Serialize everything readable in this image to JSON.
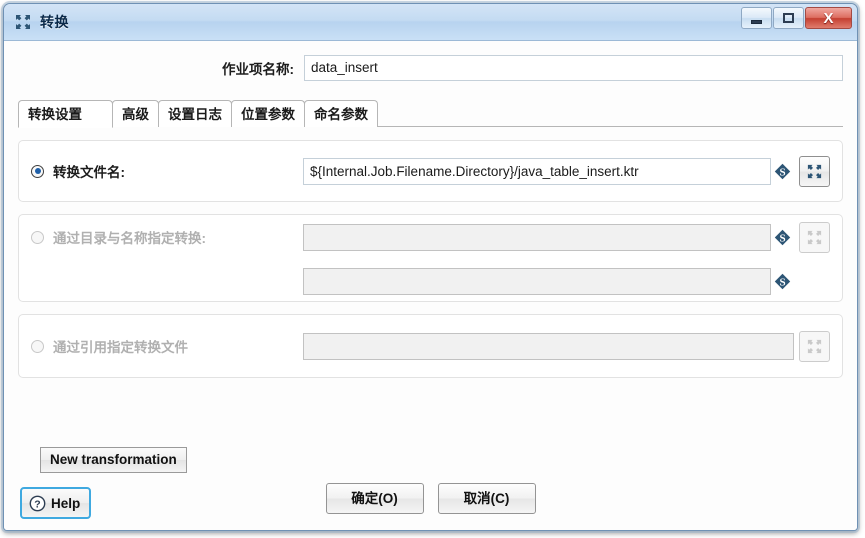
{
  "window": {
    "title": "转换",
    "title_icon": "collapse-arrows-icon",
    "controls": {
      "minimize": "minimize-icon",
      "maximize": "maximize-icon",
      "close": "X"
    }
  },
  "form": {
    "job_name_label": "作业项名称:",
    "job_name_value": "data_insert",
    "job_name_placeholder": ""
  },
  "tabs": [
    {
      "label": "转换设置",
      "active": true
    },
    {
      "label": "高级",
      "active": false
    },
    {
      "label": "设置日志",
      "active": false
    },
    {
      "label": "位置参数",
      "active": false
    },
    {
      "label": "命名参数",
      "active": false
    }
  ],
  "options": {
    "by_filename": {
      "label": "转换文件名:",
      "selected": true,
      "enabled": true,
      "value": "${Internal.Job.Filename.Directory}/java_table_insert.ktr",
      "variable_icon": "variable-dollar-icon",
      "browse_icon": "browse-collapse-icon"
    },
    "by_directory_name": {
      "label": "通过目录与名称指定转换:",
      "selected": false,
      "enabled": false,
      "directory_value": "",
      "name_value": "",
      "variable_icon": "variable-dollar-icon",
      "browse_icon": "browse-collapse-icon"
    },
    "by_reference": {
      "label": "通过引用指定转换文件",
      "selected": false,
      "enabled": false,
      "value": "",
      "browse_icon": "browse-collapse-icon"
    }
  },
  "buttons": {
    "new_transformation": "New transformation",
    "ok": "确定(O)",
    "cancel": "取消(C)",
    "help": "Help",
    "help_icon": "question-circle-icon"
  },
  "colors": {
    "titlebar": "#c4dbf2",
    "close_button": "#c43f31",
    "radio_selected": "#1f5fa8",
    "variable_icon": "#2d5575",
    "help_focus_ring": "#3fa9e0"
  }
}
